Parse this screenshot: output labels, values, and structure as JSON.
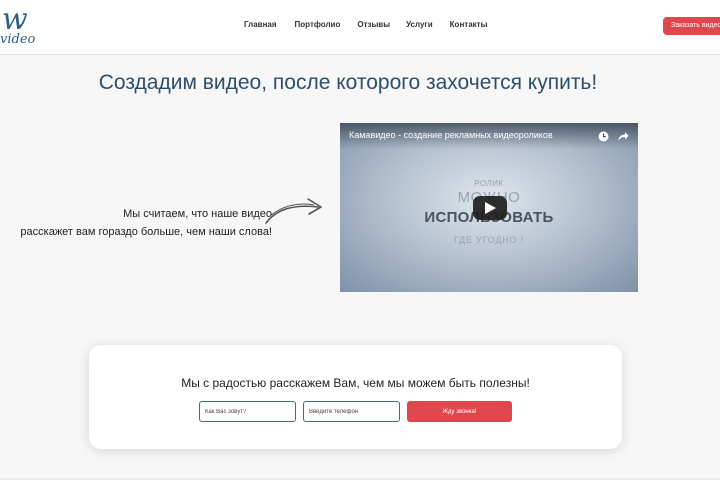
{
  "header": {
    "logo": {
      "mark": "w",
      "text": "video"
    },
    "nav": [
      "Главная",
      "Портфолио",
      "Отзывы",
      "Услуги",
      "Контакты"
    ],
    "order_button": "Заказать видео",
    "accent_color": "#e0474c"
  },
  "headline": "Создадим видео, после которого захочется купить!",
  "claim": {
    "line1": "Мы считаем, что наше видео",
    "line2": "расскажет вам гораздо больше, чем наши слова!"
  },
  "video": {
    "title": "Камавидео - создание рекламных видеороликов",
    "line1": "РОЛИК",
    "line2": "МОЖНО",
    "line3": "ИСПОЛЬЗОВАТЬ",
    "line4": "ГДЕ УГОДНО !",
    "icons": [
      "clock-icon",
      "share-icon",
      "play-icon"
    ]
  },
  "form": {
    "title": "Мы с радостью расскажем Вам, чем мы можем быть полезны!",
    "name_placeholder": "Как Вас зовут?",
    "phone_placeholder": "Введите телефон",
    "submit_label": "Жду звонка!"
  }
}
